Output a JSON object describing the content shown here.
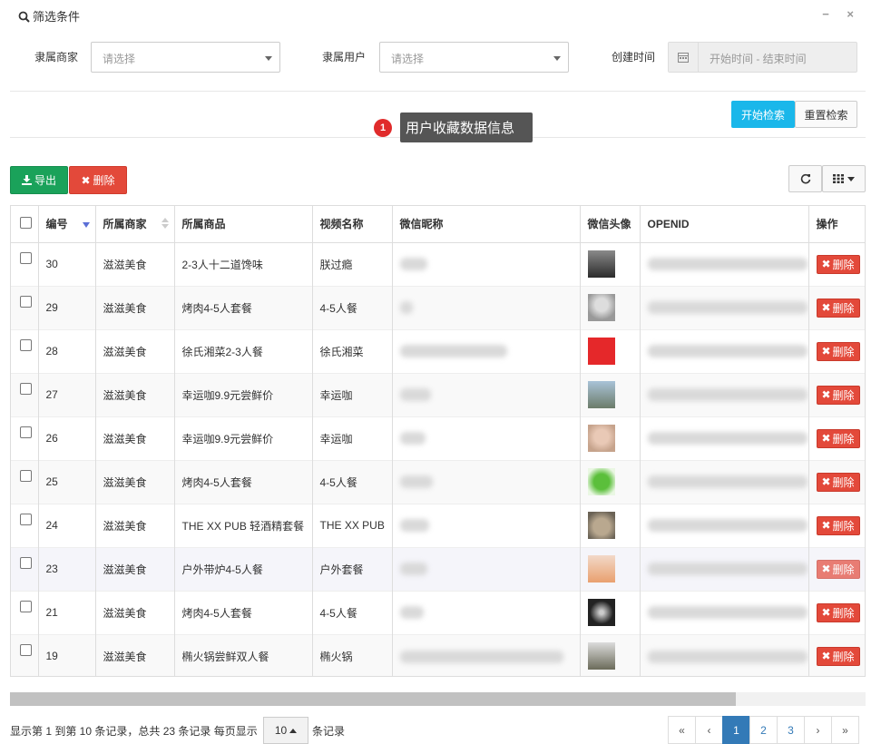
{
  "panel": {
    "title": "筛选条件",
    "minimize": "−",
    "close": "×"
  },
  "filters": {
    "merchant_label": "隶属商家",
    "merchant_placeholder": "请选择",
    "user_label": "隶属用户",
    "user_placeholder": "请选择",
    "time_label": "创建时间",
    "time_placeholder": "开始时间 - 结束时间"
  },
  "actions": {
    "search": "开始检索",
    "reset": "重置检索",
    "export": "导出",
    "delete": "删除"
  },
  "tooltip": {
    "badge": "1",
    "text": "用户收藏数据信息"
  },
  "table": {
    "headers": [
      "编号",
      "所属商家",
      "所属商品",
      "视频名称",
      "微信昵称",
      "微信头像",
      "OPENID",
      "操作"
    ],
    "delete_label": "删除",
    "rows": [
      {
        "id": "30",
        "merchant": "滋滋美食",
        "product": "2-3人十二道馋味",
        "video": "朕过瘾"
      },
      {
        "id": "29",
        "merchant": "滋滋美食",
        "product": "烤肉4-5人套餐",
        "video": "4-5人餐"
      },
      {
        "id": "28",
        "merchant": "滋滋美食",
        "product": "徐氏湘菜2-3人餐",
        "video": "徐氏湘菜"
      },
      {
        "id": "27",
        "merchant": "滋滋美食",
        "product": "幸运咖9.9元尝鲜价",
        "video": "幸运咖"
      },
      {
        "id": "26",
        "merchant": "滋滋美食",
        "product": "幸运咖9.9元尝鲜价",
        "video": "幸运咖"
      },
      {
        "id": "25",
        "merchant": "滋滋美食",
        "product": "烤肉4-5人套餐",
        "video": "4-5人餐"
      },
      {
        "id": "24",
        "merchant": "滋滋美食",
        "product": "THE XX PUB 轻酒精套餐",
        "video": "THE XX PUB"
      },
      {
        "id": "23",
        "merchant": "滋滋美食",
        "product": "户外带炉4-5人餐",
        "video": "户外套餐"
      },
      {
        "id": "21",
        "merchant": "滋滋美食",
        "product": "烤肉4-5人套餐",
        "video": "4-5人餐"
      },
      {
        "id": "19",
        "merchant": "滋滋美食",
        "product": "椭火锅尝鲜双人餐",
        "video": "椭火锅"
      }
    ]
  },
  "footer": {
    "info": "显示第 1 到第 10 条记录，总共 23 条记录 每页显示",
    "page_size": "10",
    "info_suffix": "条记录",
    "pages": [
      "«",
      "‹",
      "1",
      "2",
      "3",
      "›",
      "»"
    ]
  },
  "colors": {
    "search_btn": "#1ab7ea",
    "export_btn": "#1aa25a",
    "delete_btn": "#e3493a",
    "pager_active": "#337ab7"
  }
}
